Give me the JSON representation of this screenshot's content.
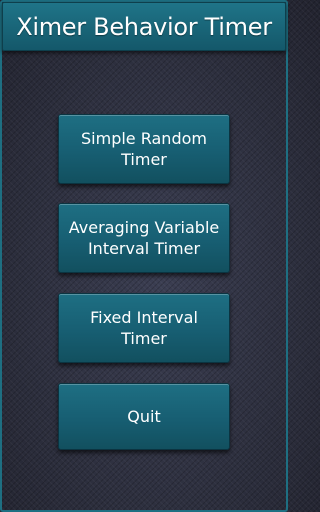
{
  "app": {
    "title": "Ximer Behavior Timer"
  },
  "menu": {
    "buttons": [
      {
        "label": "Simple Random\nTimer"
      },
      {
        "label": "Averaging Variable\nInterval Timer"
      },
      {
        "label": "Fixed Interval\nTimer"
      },
      {
        "label": "Quit"
      }
    ]
  },
  "colors": {
    "accent": "#1a6477",
    "background": "#323445",
    "text": "#ffffff"
  }
}
